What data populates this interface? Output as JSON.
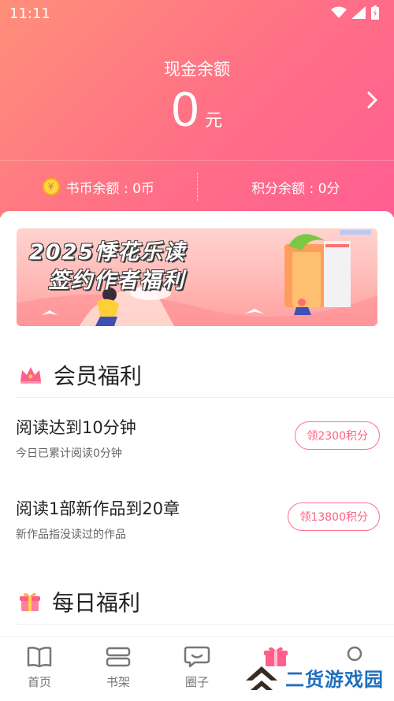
{
  "status_bar": {
    "time": "11:11"
  },
  "wallet": {
    "cash_label": "现金余额",
    "cash_value": "0",
    "cash_unit": "元",
    "coin_balance": "书币余额 : 0币",
    "points_balance": "积分余额 : 0分"
  },
  "banner": {
    "line1": "2025悸花乐读",
    "line2": "签约作者福利"
  },
  "member_section": {
    "title": "会员福利",
    "tasks": [
      {
        "title": "阅读达到10分钟",
        "subtitle": "今日已累计阅读0分钟",
        "button": "领2300积分"
      },
      {
        "title": "阅读1部新作品到20章",
        "subtitle": "新作品指没读过的作品",
        "button": "领13800积分"
      }
    ]
  },
  "daily_section": {
    "title": "每日福利"
  },
  "nav": {
    "items": [
      {
        "label": "首页",
        "icon": "book-open-icon"
      },
      {
        "label": "书架",
        "icon": "bookshelf-icon"
      },
      {
        "label": "圈子",
        "icon": "chat-bubble-icon"
      },
      {
        "label": "",
        "icon": "gift-icon"
      },
      {
        "label": "",
        "icon": "profile-icon"
      }
    ]
  },
  "watermark": {
    "text": "二货游戏园"
  },
  "colors": {
    "accent": "#ff6f8e",
    "header_start": "#ff8f79",
    "header_end": "#ff5e92"
  }
}
